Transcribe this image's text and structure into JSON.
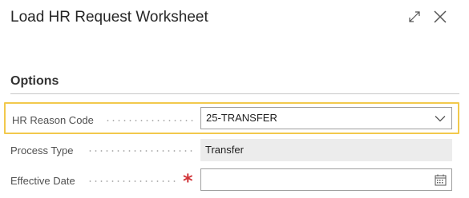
{
  "dialog": {
    "title": "Load HR Request Worksheet",
    "expand_icon": "expand-diagonal-icon",
    "close_icon": "close-x-icon"
  },
  "section": {
    "title": "Options"
  },
  "fields": {
    "hr_reason_code": {
      "label": "HR Reason Code",
      "value": "25-TRANSFER",
      "icon": "chevron-down-icon"
    },
    "process_type": {
      "label": "Process Type",
      "value": "Transfer"
    },
    "effective_date": {
      "label": "Effective Date",
      "value": "",
      "required_marker": "*",
      "icon": "calendar-icon"
    }
  },
  "colors": {
    "focus_outline": "#f2c94c",
    "required": "#d13438",
    "readonly_background": "#ececec"
  }
}
